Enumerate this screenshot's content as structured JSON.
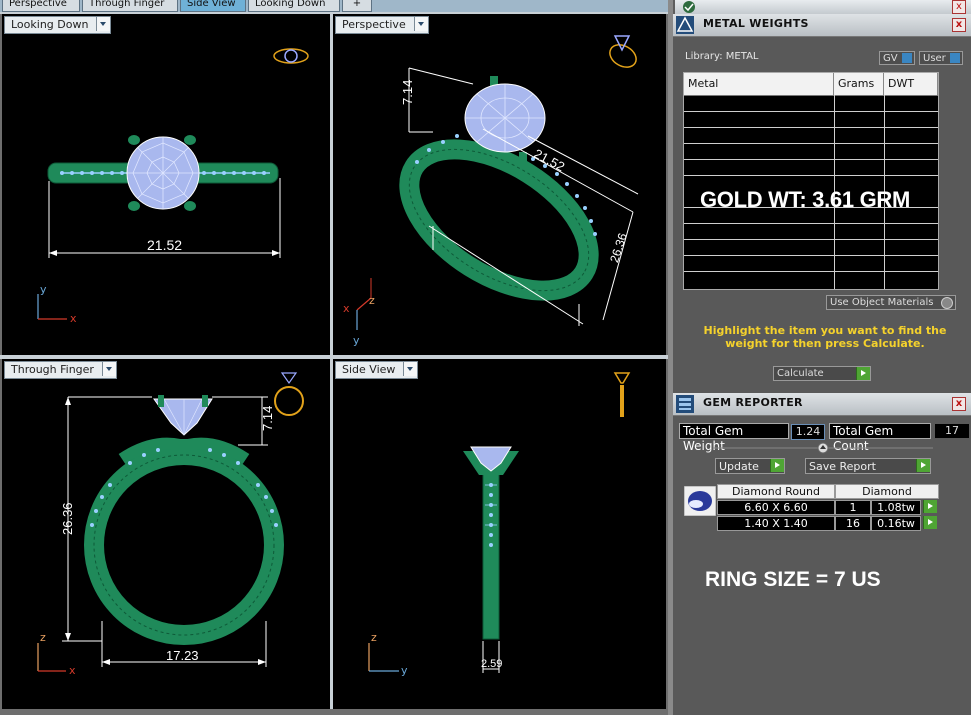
{
  "tabs": [
    "Perspective",
    "Through Finger",
    "Side View",
    "Looking Down",
    "+"
  ],
  "active_tab": "Side View",
  "viewports": [
    {
      "label": "Looking Down",
      "dimensions": [
        "21.52"
      ],
      "axes": [
        "y",
        "x"
      ]
    },
    {
      "label": "Perspective",
      "dimensions": [
        "7.14",
        "21.52",
        "26.36"
      ],
      "axes": [
        "z",
        "x",
        "y"
      ]
    },
    {
      "label": "Through Finger",
      "dimensions": [
        "26.36",
        "7.14",
        "17.23"
      ],
      "axes": [
        "z",
        "x"
      ]
    },
    {
      "label": "Side View",
      "dimensions": [
        "2.59"
      ],
      "axes": [
        "z",
        "y"
      ]
    }
  ],
  "metal_panel": {
    "title": "METAL WEIGHTS",
    "library_label": "Library: METAL",
    "gv_label": "GV",
    "user_label": "User",
    "columns": [
      "Metal",
      "Grams",
      "DWT"
    ],
    "overlay_text": "GOLD WT: 3.61 GRM",
    "use_object_materials": "Use Object Materials",
    "instruction": "Highlight the item you want to find the weight for then press Calculate.",
    "calculate_label": "Calculate"
  },
  "gem_panel": {
    "title": "GEM REPORTER",
    "total_weight_label": "Total Gem Weight",
    "total_weight_value": "1.24",
    "total_count_label": "Total Gem Count",
    "total_count_value": "17",
    "update_label": "Update",
    "save_report_label": "Save Report",
    "table_headers": [
      "Diamond Round",
      "Diamond"
    ],
    "rows": [
      {
        "size": "6.60 X 6.60",
        "count": "1",
        "tw": "1.08tw"
      },
      {
        "size": "1.40 X 1.40",
        "count": "16",
        "tw": "0.16tw"
      }
    ],
    "ring_size_text": "RING SIZE = 7 US"
  },
  "colors": {
    "ring_green": "#1f8a5a",
    "gem_blue": "#a9b8ee",
    "dimension_white": "#ffffff",
    "instruction_yellow": "#f5d22c",
    "axis_red": "#d43a2a",
    "axis_blue": "#6aa8d8",
    "thumb_gold": "#e2a21a"
  }
}
